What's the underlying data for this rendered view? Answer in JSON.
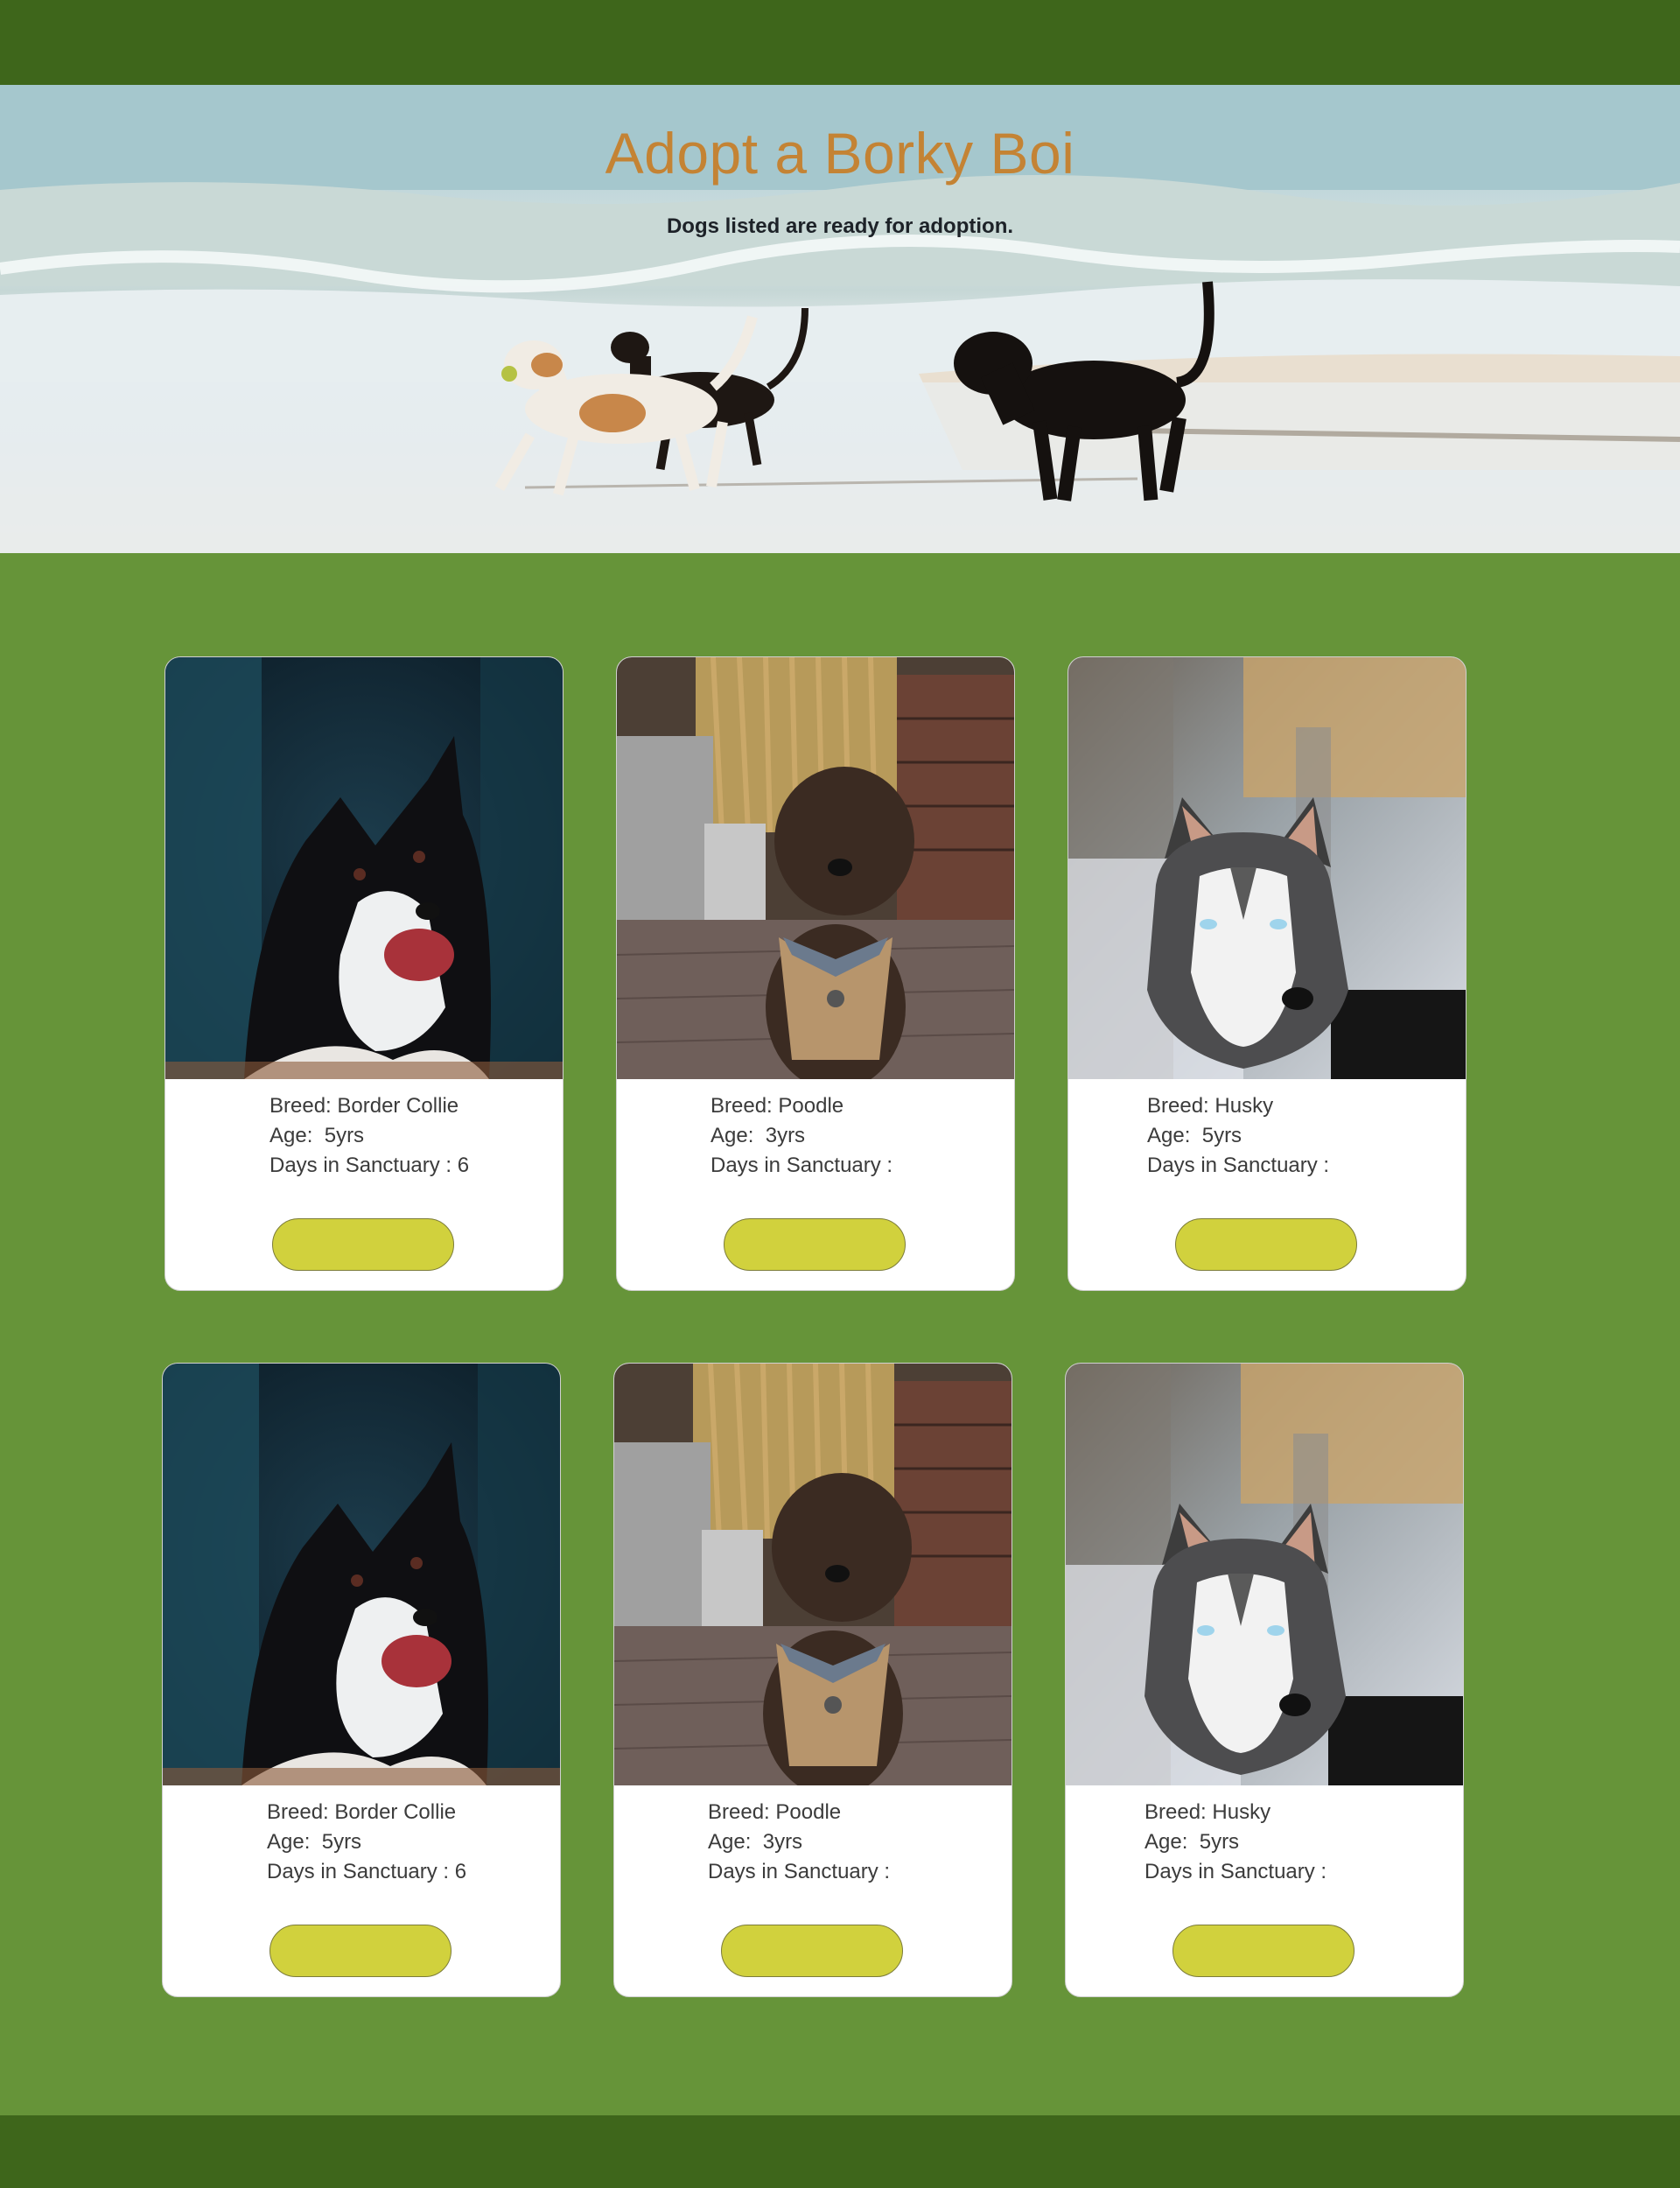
{
  "hero": {
    "title": "Adopt a Borky Boi",
    "subtitle": "Dogs listed are ready for adoption."
  },
  "colors": {
    "top_bar": "#3e661b",
    "page_background": "#669439",
    "title": "#c48334",
    "adopt_button": "#d1d13d"
  },
  "labels": {
    "breed": "Breed: ",
    "age": "Age:  ",
    "days": "Days in Sanctuary : "
  },
  "cards": [
    {
      "photo": "border-collie-photo",
      "breed": "Border Collie",
      "age": "5yrs",
      "days": "6"
    },
    {
      "photo": "poodle-photo",
      "breed": "Poodle",
      "age": "3yrs",
      "days": ""
    },
    {
      "photo": "husky-photo",
      "breed": "Husky",
      "age": "5yrs",
      "days": ""
    },
    {
      "photo": "border-collie-photo",
      "breed": "Border Collie",
      "age": "5yrs",
      "days": "6"
    },
    {
      "photo": "poodle-photo",
      "breed": "Poodle",
      "age": "3yrs",
      "days": ""
    },
    {
      "photo": "husky-photo",
      "breed": "Husky",
      "age": "5yrs",
      "days": ""
    }
  ]
}
